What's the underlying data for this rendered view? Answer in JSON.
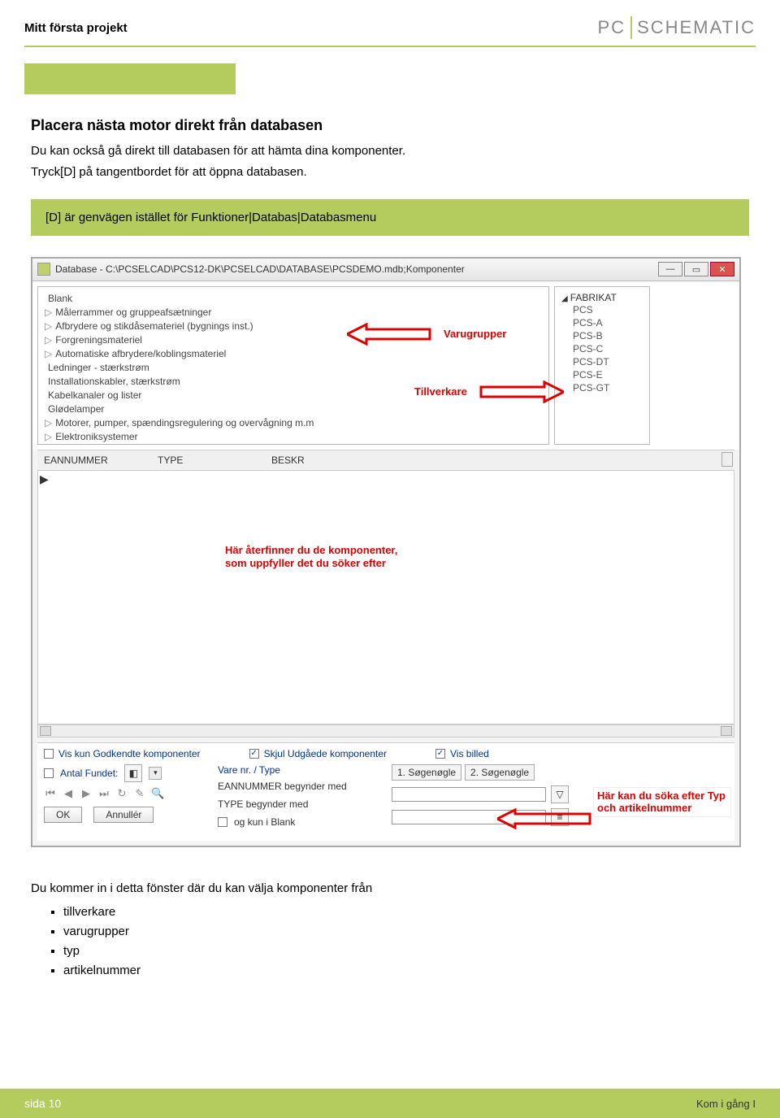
{
  "header": {
    "doc_title": "Mitt första projekt",
    "logo_left": "PC",
    "logo_right": "SCHEMATIC"
  },
  "section": {
    "heading": "Placera nästa motor direkt från databasen",
    "line1": "Du kan också gå direkt till databasen för att hämta dina komponenter.",
    "line2": "Tryck[D] på tangentbordet för att öppna databasen.",
    "tip": "[D] är genvägen istället för Funktioner|Databas|Databasmenu"
  },
  "window": {
    "title": "Database - C:\\PCSELCAD\\PCS12-DK\\PCSELCAD\\DATABASE\\PCSDEMO.mdb;Komponenter",
    "left_tree": [
      "Blank",
      "Målerrammer og gruppeafsætninger",
      "Afbrydere og stikdåsemateriel (bygnings inst.)",
      "Forgreningsmateriel",
      "Automatiske afbrydere/koblingsmateriel",
      "Ledninger - stærkstrøm",
      "Installationskabler, stærkstrøm",
      "Kabelkanaler og lister",
      "Glødelamper",
      "Motorer, pumper, spændingsregulering og overvågning m.m",
      "Elektroniksystemer"
    ],
    "right_root": "FABRIKAT",
    "right_items": [
      "PCS",
      "PCS-A",
      "PCS-B",
      "PCS-C",
      "PCS-DT",
      "PCS-E",
      "PCS-GT"
    ],
    "grid_headers": {
      "c1": "EANNUMMER",
      "c2": "TYPE",
      "c3": "BESKR"
    },
    "annotations": {
      "varugrupper": "Varugrupper",
      "tillverkare": "Tillverkare",
      "results_line1": "Här återfinner du de komponenter,",
      "results_line2": "som uppfyller det du söker efter",
      "search_line1": "Här kan du söka efter Typ",
      "search_line2": "och artikelnummer"
    },
    "checks": {
      "vis_godkendte": "Vis kun Godkendte komponenter",
      "skjul_udgaede": "Skjul Udgåede komponenter",
      "vis_billed": "Vis billed",
      "antal_fundet": "Antal Fundet:",
      "og_kun_blank": "og kun i Blank"
    },
    "radio": {
      "label": "Vare nr. / Type",
      "seg1": "1. Søgenøgle",
      "seg2": "2. Søgenøgle"
    },
    "search_labels": {
      "ean": "EANNUMMER begynder med",
      "type": "TYPE begynder med"
    },
    "buttons": {
      "ok": "OK",
      "cancel": "Annullér"
    }
  },
  "after": {
    "intro": "Du kommer in i detta fönster där du kan välja komponenter från",
    "bullets": [
      "tillverkare",
      "varugrupper",
      "typ",
      "artikelnummer"
    ]
  },
  "footer": {
    "left": "sida 10",
    "right": "Kom i gång I"
  }
}
